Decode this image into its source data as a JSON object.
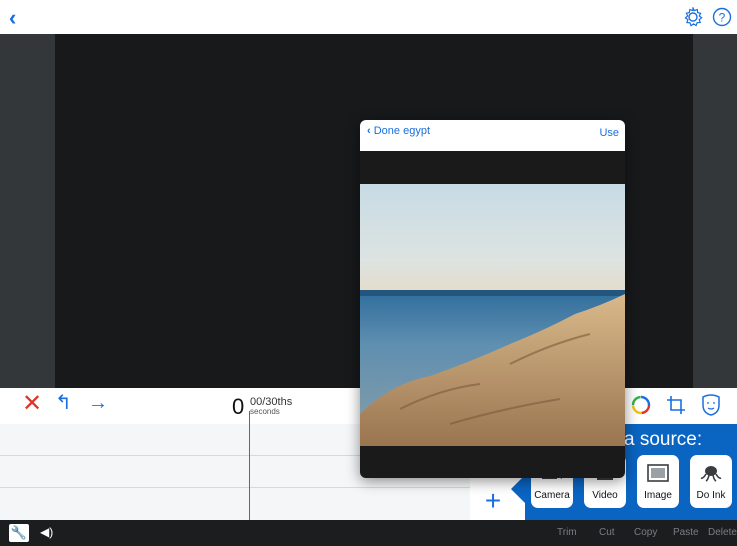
{
  "topbar": {
    "back_icon": "chevron-left-icon",
    "settings_icon": "gear-icon",
    "help_icon": "question-icon"
  },
  "toolbar": {
    "close_icon": "x-icon",
    "undo_icon": "undo-icon",
    "redo_icon": "redo-icon",
    "time_seconds": "0",
    "time_fraction": "00/30ths",
    "time_unit": "seconds",
    "color_icon": "color-wheel-icon",
    "crop_icon": "crop-icon",
    "mask_icon": "mask-icon"
  },
  "media_source": {
    "title": "a source:",
    "options": [
      {
        "label": "Camera",
        "icon": "camera-icon"
      },
      {
        "label": "Video",
        "icon": "film-icon"
      },
      {
        "label": "Image",
        "icon": "image-icon"
      },
      {
        "label": "Do Ink",
        "icon": "octopus-icon"
      }
    ],
    "add_symbol": "+"
  },
  "bottombar": {
    "wrench_icon": "wrench-icon",
    "speaker_icon": "speaker-icon",
    "actions": [
      "Trim",
      "Cut",
      "Copy",
      "Paste",
      "Delete"
    ]
  },
  "popover": {
    "back_label": "Done egypt",
    "use_label": "Use"
  },
  "colors": {
    "accent": "#1a6fe0",
    "danger": "#e0352b",
    "panel_blue": "#0a64c2",
    "canvas": "#17191b"
  }
}
